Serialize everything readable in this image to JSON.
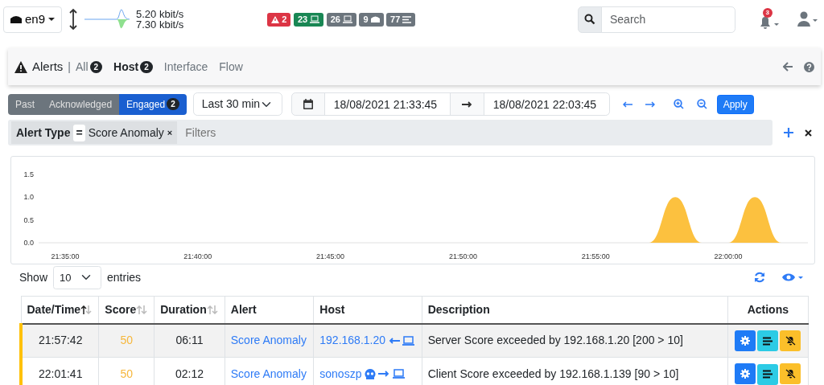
{
  "navbar": {
    "interface": "en9",
    "upload": "5.20 kbit/s",
    "download": "7.30 kbit/s",
    "badges": [
      {
        "text": "2",
        "kind": "alert",
        "color": "#dc3545"
      },
      {
        "text": "23",
        "kind": "hosts",
        "color": "#198754"
      },
      {
        "text": "26",
        "kind": "devices",
        "color": "#6c757d"
      },
      {
        "text": "9",
        "kind": "interfaces",
        "color": "#6c757d"
      },
      {
        "text": "77",
        "kind": "flows",
        "color": "#6c757d"
      }
    ],
    "search": {
      "placeholder": "Search"
    },
    "notifications": "3"
  },
  "header": {
    "title": "Alerts",
    "separator": "|",
    "tabs": [
      {
        "label": "All",
        "count": "2",
        "selected": false
      },
      {
        "label": "Host",
        "count": "2",
        "selected": true
      },
      {
        "label": "Interface",
        "selected": false
      },
      {
        "label": "Flow",
        "selected": false
      }
    ]
  },
  "status_buttons": [
    {
      "label": "Past",
      "selected": false
    },
    {
      "label": "Acknowledged",
      "selected": false
    },
    {
      "label": "Engaged",
      "count": "2",
      "selected": true
    }
  ],
  "range": {
    "preset": "Last 30 min",
    "begin": "18/08/2021 21:33:45",
    "end": "18/08/2021 22:03:45",
    "apply": "Apply"
  },
  "filters": {
    "items": [
      {
        "label": "Alert Type",
        "operator": "=",
        "value": "Score Anomaly",
        "remove": "×"
      }
    ],
    "placeholder": "Filters"
  },
  "chart": {
    "chart_data": {
      "type": "area",
      "ylim": [
        0,
        1.5
      ],
      "yticks": [
        {
          "value": 0,
          "label": "0.0"
        },
        {
          "value": 0.5,
          "label": "0.5"
        },
        {
          "value": 1,
          "label": "1.0"
        },
        {
          "value": 1.5,
          "label": "1.5"
        }
      ],
      "categories": [
        null,
        "21:35:00",
        null,
        null,
        null,
        null,
        "21:40:00",
        null,
        null,
        null,
        null,
        "21:45:00",
        null,
        null,
        null,
        null,
        "21:50:00",
        null,
        null,
        null,
        null,
        "21:55:00",
        null,
        null,
        null,
        null,
        "22:00:00",
        null,
        null,
        null
      ],
      "series": [
        {
          "color": "#fcc13f",
          "values": [
            0,
            0,
            0,
            0,
            0,
            0,
            0,
            0,
            0,
            0,
            0,
            0,
            0,
            0,
            0,
            0,
            0,
            0,
            0,
            0,
            0,
            0,
            0,
            0,
            1,
            0,
            0,
            1,
            0,
            0
          ]
        }
      ]
    }
  },
  "table": {
    "show": "Show",
    "page_length": "10",
    "entries": "entries",
    "columns": [
      {
        "label": "Date/Time",
        "sortable": true,
        "sorted": true
      },
      {
        "label": "Score",
        "sortable": true,
        "sorted": false
      },
      {
        "label": "Duration",
        "sortable": true,
        "sorted": false
      },
      {
        "label": "Alert"
      },
      {
        "label": "Host"
      },
      {
        "label": "Description"
      },
      {
        "label": "Actions"
      }
    ],
    "rows": [
      {
        "time": "21:57:42",
        "score": "50",
        "duration": "06:11",
        "alert": "Score Anomaly",
        "host": "192.168.1.20",
        "reversed": true,
        "flagged": false,
        "description": "Server Score exceeded by 192.168.1.20 [200 > 10]"
      },
      {
        "time": "22:01:41",
        "score": "50",
        "duration": "02:12",
        "alert": "Score Anomaly",
        "host": "sonoszp",
        "reversed": false,
        "flagged": true,
        "description": "Client Score exceeded by 192.168.1.139 [90 > 10]"
      }
    ]
  }
}
